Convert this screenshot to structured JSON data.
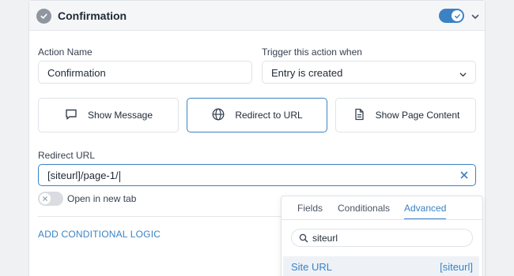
{
  "header": {
    "title": "Confirmation",
    "enabled": true
  },
  "form": {
    "action_name_label": "Action Name",
    "action_name_value": "Confirmation",
    "trigger_label": "Trigger this action when",
    "trigger_value": "Entry is created"
  },
  "options": [
    {
      "label": "Show Message",
      "icon": "message-icon",
      "selected": false
    },
    {
      "label": "Redirect to URL",
      "icon": "globe-icon",
      "selected": true
    },
    {
      "label": "Show Page Content",
      "icon": "document-icon",
      "selected": false
    }
  ],
  "redirect": {
    "label": "Redirect URL",
    "value": "[siteurl]/page-1/",
    "new_tab_label": "Open in new tab",
    "new_tab_enabled": false
  },
  "conditional_logic_label": "ADD CONDITIONAL LOGIC",
  "popover": {
    "tabs": [
      {
        "label": "Fields",
        "active": false
      },
      {
        "label": "Conditionals",
        "active": false
      },
      {
        "label": "Advanced",
        "active": true
      }
    ],
    "search_value": "siteurl",
    "results": [
      {
        "name": "Site URL",
        "tag": "[siteurl]"
      }
    ]
  },
  "colors": {
    "accent": "#3b82c4",
    "header_bg": "#f5f6f8",
    "border": "#dfe3e8"
  }
}
